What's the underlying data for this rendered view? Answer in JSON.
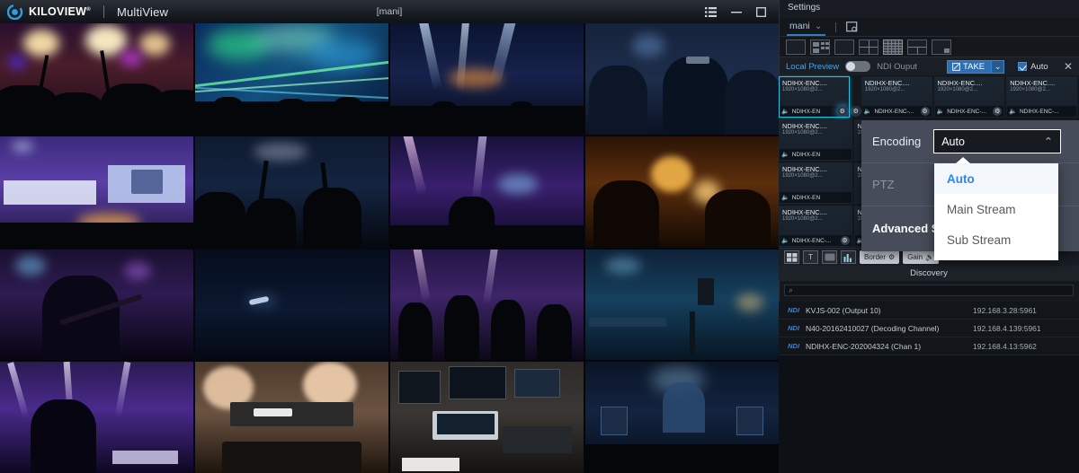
{
  "titlebar": {
    "brand": "KILOVIEW",
    "brand_sup": "®",
    "brand_sub": "MultiView",
    "window_title": "[mani]",
    "controls": [
      {
        "name": "menu-list-icon",
        "glyph": "list"
      },
      {
        "name": "minimize-icon",
        "glyph": "minimize"
      },
      {
        "name": "maximize-icon",
        "glyph": "maximize"
      }
    ]
  },
  "panel": {
    "title": "Settings",
    "tab": {
      "label": "mani",
      "chevron": "⌄"
    },
    "save_layout_icon": "save-layout-icon",
    "layouts": [
      {
        "name": "layout-single",
        "selected": false
      },
      {
        "name": "layout-pip-grid",
        "selected": false
      },
      {
        "name": "layout-solo",
        "selected": false
      },
      {
        "name": "layout-quad",
        "selected": false
      },
      {
        "name": "layout-dense-grid",
        "selected": true
      },
      {
        "name": "layout-one-plus-three",
        "selected": false
      },
      {
        "name": "layout-corner-pip",
        "selected": false
      }
    ],
    "preview_bar": {
      "local_preview_label": "Local Preview",
      "ndi_output_label": "NDI Ouput",
      "toggle_on": false,
      "take_label": "TAKE",
      "take_arrow": "⌄",
      "auto_label": "Auto",
      "auto_checked": true,
      "close_label": "✕"
    }
  },
  "tiles": {
    "name": "NDIHX-ENC....",
    "resolution": "1920×1080@2...",
    "bar_name": "NDIHX-ENC-...",
    "bar_name_short": "NDIHX-EN",
    "rows": 4,
    "cols": 4
  },
  "context_menu": {
    "encoding_label": "Encoding",
    "encoding_value": "Auto",
    "encoding_carat": "⌃",
    "ptz_label": "PTZ",
    "advanced_label": "Advanced Se",
    "options": [
      {
        "label": "Auto",
        "selected": true
      },
      {
        "label": "Main Stream",
        "selected": false
      },
      {
        "label": "Sub Stream",
        "selected": false
      }
    ]
  },
  "midbar": {
    "icons": [
      {
        "name": "grid-icon",
        "glyph": "grid"
      },
      {
        "name": "text-icon",
        "glyph": "T"
      },
      {
        "name": "image-icon",
        "glyph": "img"
      },
      {
        "name": "audio-meter-icon",
        "glyph": "bars"
      }
    ],
    "border_label": "Border",
    "border_icon": "⚙",
    "gain_label": "Gain",
    "gain_icon": "🔊"
  },
  "discovery": {
    "title": "Discovery",
    "search_placeholder": "",
    "search_icon": "⌕",
    "items": [
      {
        "tag": "NDI",
        "name": "KVJS-002 (Output 10)",
        "ip": "192.168.3.28:5961"
      },
      {
        "tag": "NDI",
        "name": "N40-20162410027 (Decoding Channel)",
        "ip": "192.168.4.139:5961"
      },
      {
        "tag": "NDI",
        "name": "NDIHX-ENC-202004324 (Chan 1)",
        "ip": "192.168.4.13:5962"
      }
    ]
  },
  "wall": {
    "cells": [
      {
        "name": "concert-crowd-hands",
        "scene": "crowd-warm"
      },
      {
        "name": "laser-show-green",
        "scene": "laser-green"
      },
      {
        "name": "stage-lights-blue",
        "scene": "stage-blue"
      },
      {
        "name": "worship-crew",
        "scene": "crew-dark"
      },
      {
        "name": "church-stage-screen",
        "scene": "church-screen"
      },
      {
        "name": "crowd-hands-raised",
        "scene": "hands-dark"
      },
      {
        "name": "stage-singer-purple",
        "scene": "singer-purple"
      },
      {
        "name": "saxophone-player",
        "scene": "sax-warm"
      },
      {
        "name": "guitarist-live",
        "scene": "guitarist"
      },
      {
        "name": "night-water-boat",
        "scene": "water-night"
      },
      {
        "name": "choir-singers",
        "scene": "choir"
      },
      {
        "name": "studio-camera-set",
        "scene": "studio-set"
      },
      {
        "name": "dj-stage-purple",
        "scene": "dj-purple"
      },
      {
        "name": "hands-encoder-camera",
        "scene": "encoder-hands"
      },
      {
        "name": "control-room-desk",
        "scene": "control-room"
      },
      {
        "name": "outdoor-festival",
        "scene": "festival"
      }
    ]
  }
}
